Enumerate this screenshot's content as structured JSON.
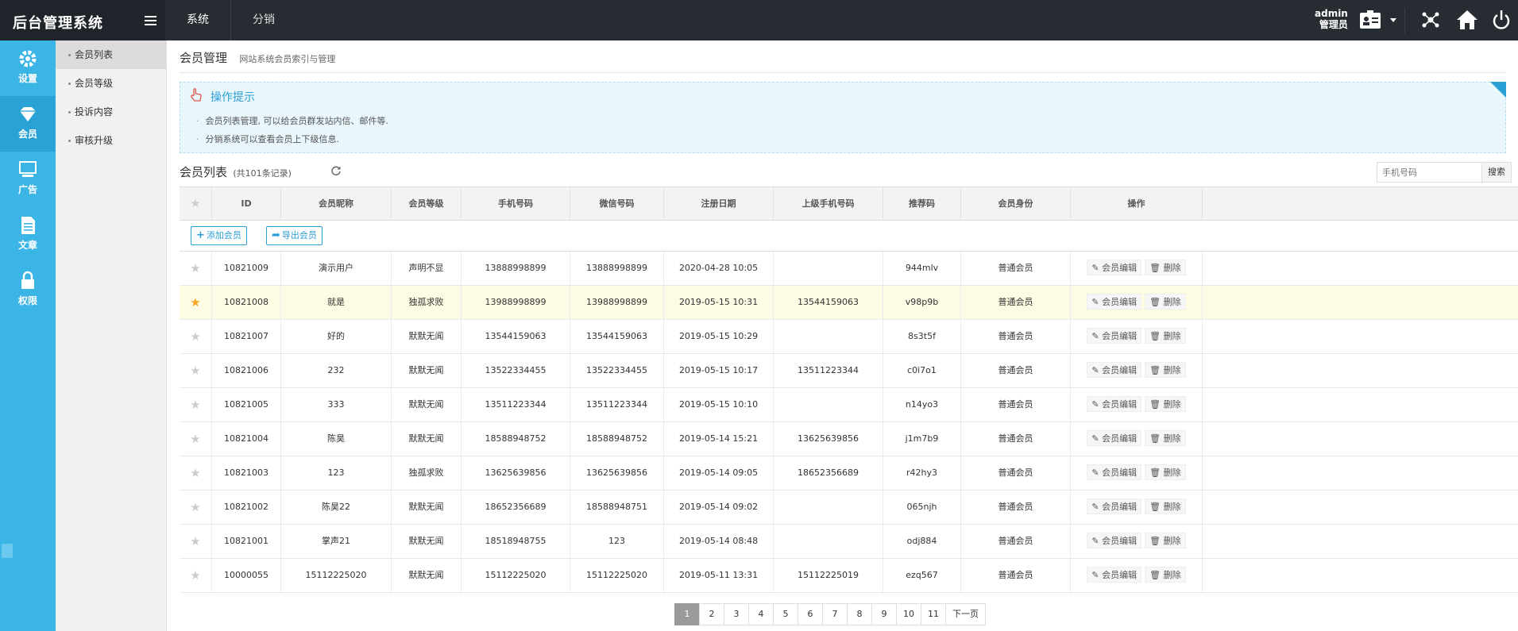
{
  "app": {
    "title": "后台管理系统"
  },
  "topnav": [
    {
      "label": "系统"
    },
    {
      "label": "分销"
    }
  ],
  "user": {
    "name": "admin",
    "role": "管理员"
  },
  "iconbar": [
    {
      "label": "设置",
      "icon": "gear-icon"
    },
    {
      "label": "会员",
      "icon": "diamond-icon"
    },
    {
      "label": "广告",
      "icon": "ad-icon"
    },
    {
      "label": "文章",
      "icon": "document-icon"
    },
    {
      "label": "权限",
      "icon": "lock-icon"
    }
  ],
  "submenu": [
    {
      "label": "会员列表"
    },
    {
      "label": "会员等级"
    },
    {
      "label": "投诉内容"
    },
    {
      "label": "审核升级"
    }
  ],
  "page": {
    "title": "会员管理",
    "subtitle": "网站系统会员索引与管理"
  },
  "tips": {
    "title": "操作提示",
    "lines": [
      "会员列表管理, 可以给会员群发站内信、邮件等.",
      "分销系统可以查看会员上下级信息."
    ]
  },
  "list": {
    "title": "会员列表",
    "count": "(共101条记录)"
  },
  "search": {
    "placeholder": "手机号码",
    "button": "搜索"
  },
  "toolbar": {
    "add": "添加会员",
    "export": "导出会员"
  },
  "columns": [
    "ID",
    "会员昵称",
    "会员等级",
    "手机号码",
    "微信号码",
    "注册日期",
    "上级手机号码",
    "推荐码",
    "会员身份",
    "操作"
  ],
  "actions": {
    "edit": "会员编辑",
    "delete": "删除"
  },
  "rows": [
    {
      "starred": false,
      "id": "10821009",
      "nickname": "演示用户",
      "level": "声明不显",
      "phone": "13888998899",
      "wechat": "13888998899",
      "date": "2020-04-28 10:05",
      "parent": "",
      "code": "944mlv",
      "identity": "普通会员"
    },
    {
      "starred": true,
      "id": "10821008",
      "nickname": "就是",
      "level": "独孤求败",
      "phone": "13988998899",
      "wechat": "13988998899",
      "date": "2019-05-15 10:31",
      "parent": "13544159063",
      "code": "v98p9b",
      "identity": "普通会员"
    },
    {
      "starred": false,
      "id": "10821007",
      "nickname": "好的",
      "level": "默默无闻",
      "phone": "13544159063",
      "wechat": "13544159063",
      "date": "2019-05-15 10:29",
      "parent": "",
      "code": "8s3t5f",
      "identity": "普通会员"
    },
    {
      "starred": false,
      "id": "10821006",
      "nickname": "232",
      "level": "默默无闻",
      "phone": "13522334455",
      "wechat": "13522334455",
      "date": "2019-05-15 10:17",
      "parent": "13511223344",
      "code": "c0i7o1",
      "identity": "普通会员"
    },
    {
      "starred": false,
      "id": "10821005",
      "nickname": "333",
      "level": "默默无闻",
      "phone": "13511223344",
      "wechat": "13511223344",
      "date": "2019-05-15 10:10",
      "parent": "",
      "code": "n14yo3",
      "identity": "普通会员"
    },
    {
      "starred": false,
      "id": "10821004",
      "nickname": "陈昊",
      "level": "默默无闻",
      "phone": "18588948752",
      "wechat": "18588948752",
      "date": "2019-05-14 15:21",
      "parent": "13625639856",
      "code": "j1m7b9",
      "identity": "普通会员"
    },
    {
      "starred": false,
      "id": "10821003",
      "nickname": "123",
      "level": "独孤求败",
      "phone": "13625639856",
      "wechat": "13625639856",
      "date": "2019-05-14 09:05",
      "parent": "18652356689",
      "code": "r42hy3",
      "identity": "普通会员"
    },
    {
      "starred": false,
      "id": "10821002",
      "nickname": "陈昊22",
      "level": "默默无闻",
      "phone": "18652356689",
      "wechat": "18588948751",
      "date": "2019-05-14 09:02",
      "parent": "",
      "code": "065njh",
      "identity": "普通会员"
    },
    {
      "starred": false,
      "id": "10821001",
      "nickname": "掌声21",
      "level": "默默无闻",
      "phone": "18518948755",
      "wechat": "123",
      "date": "2019-05-14 08:48",
      "parent": "",
      "code": "odj884",
      "identity": "普通会员"
    },
    {
      "starred": false,
      "id": "10000055",
      "nickname": "15112225020",
      "level": "默默无闻",
      "phone": "15112225020",
      "wechat": "15112225020",
      "date": "2019-05-11 13:31",
      "parent": "15112225019",
      "code": "ezq567",
      "identity": "普通会员"
    }
  ],
  "pagination": {
    "pages": [
      "1",
      "2",
      "3",
      "4",
      "5",
      "6",
      "7",
      "8",
      "9",
      "10",
      "11"
    ],
    "current": "1",
    "next": "下一页"
  },
  "colors": {
    "topbar": "#272c33",
    "sidebar": "#3bb4e6",
    "accent": "#2a9fd6",
    "highlight_row": "#fdfbe3"
  }
}
